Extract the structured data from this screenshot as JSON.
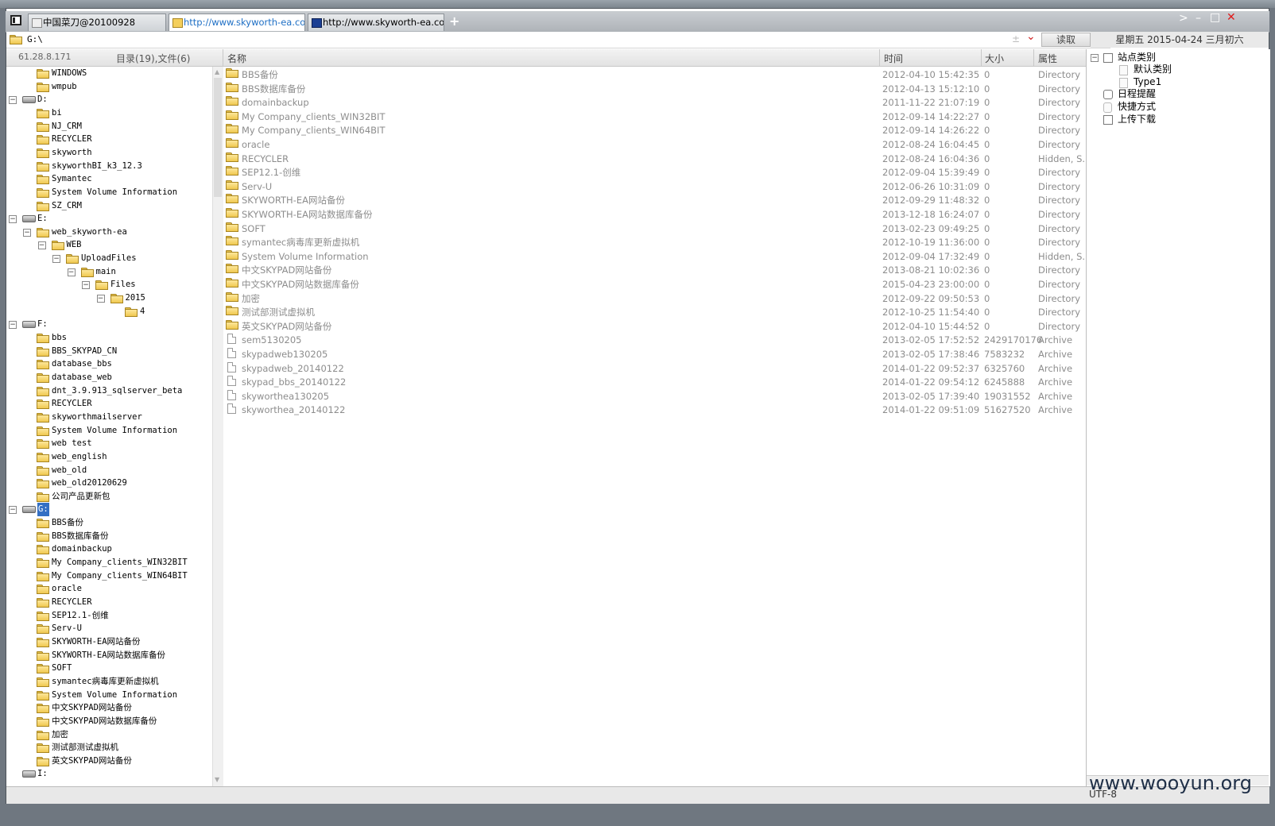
{
  "tabs": [
    {
      "label": "中国菜刀@20100928",
      "active": false
    },
    {
      "label": "http://www.skyworth-ea.com...",
      "active": true
    },
    {
      "label": "http://www.skyworth-ea.com...",
      "active": false
    }
  ],
  "add_tab": "+",
  "window_controls": {
    "next": ">",
    "minimize": "–",
    "maximize": "□",
    "close": "✕"
  },
  "address": {
    "path": "G:\\",
    "plus_minus": "±",
    "dropdown": "⌄"
  },
  "read_button": "读取",
  "date": "星期五 2015-04-24 三月初六",
  "left_header": {
    "ip": "61.28.8.171",
    "summary": "目录(19),文件(6)"
  },
  "columns": {
    "name": "名称",
    "time": "时间",
    "size": "大小",
    "attr": "属性"
  },
  "tree": [
    {
      "label": "WINDOWS",
      "kind": "folder",
      "level": 2
    },
    {
      "label": "wmpub",
      "kind": "folder",
      "level": 2
    },
    {
      "label": "D:",
      "kind": "drive",
      "level": 0,
      "exp": "-"
    },
    {
      "label": "bi",
      "kind": "folder",
      "level": 2
    },
    {
      "label": "NJ_CRM",
      "kind": "folder",
      "level": 2
    },
    {
      "label": "RECYCLER",
      "kind": "folder",
      "level": 2
    },
    {
      "label": "skyworth",
      "kind": "folder",
      "level": 2
    },
    {
      "label": "skyworthBI_k3_12.3",
      "kind": "folder",
      "level": 2
    },
    {
      "label": "Symantec",
      "kind": "folder",
      "level": 2
    },
    {
      "label": "System Volume Information",
      "kind": "folder",
      "level": 2
    },
    {
      "label": "SZ_CRM",
      "kind": "folder",
      "level": 2
    },
    {
      "label": "E:",
      "kind": "drive",
      "level": 0,
      "exp": "-"
    },
    {
      "label": "web_skyworth-ea",
      "kind": "folder",
      "level": 2,
      "exp": "-"
    },
    {
      "label": "WEB",
      "kind": "folder",
      "level": 3,
      "exp": "-"
    },
    {
      "label": "UploadFiles",
      "kind": "folder",
      "level": 4,
      "exp": "-"
    },
    {
      "label": "main",
      "kind": "folder",
      "level": 5,
      "exp": "-"
    },
    {
      "label": "Files",
      "kind": "folder",
      "level": 6,
      "exp": "-"
    },
    {
      "label": "2015",
      "kind": "folder",
      "level": 7,
      "exp": "-"
    },
    {
      "label": "4",
      "kind": "folder",
      "level": 8
    },
    {
      "label": "F:",
      "kind": "drive",
      "level": 0,
      "exp": "-"
    },
    {
      "label": "bbs",
      "kind": "folder",
      "level": 2
    },
    {
      "label": "BBS_SKYPAD_CN",
      "kind": "folder",
      "level": 2
    },
    {
      "label": "database_bbs",
      "kind": "folder",
      "level": 2
    },
    {
      "label": "database_web",
      "kind": "folder",
      "level": 2
    },
    {
      "label": "dnt_3.9.913_sqlserver_beta",
      "kind": "folder",
      "level": 2
    },
    {
      "label": "RECYCLER",
      "kind": "folder",
      "level": 2
    },
    {
      "label": "skyworthmailserver",
      "kind": "folder",
      "level": 2
    },
    {
      "label": "System Volume Information",
      "kind": "folder",
      "level": 2
    },
    {
      "label": "web test",
      "kind": "folder",
      "level": 2
    },
    {
      "label": "web_english",
      "kind": "folder",
      "level": 2
    },
    {
      "label": "web_old",
      "kind": "folder",
      "level": 2
    },
    {
      "label": "web_old20120629",
      "kind": "folder",
      "level": 2
    },
    {
      "label": "公司产品更新包",
      "kind": "folder",
      "level": 2
    },
    {
      "label": "G:",
      "kind": "drive",
      "level": 0,
      "exp": "-",
      "selected": true
    },
    {
      "label": "BBS备份",
      "kind": "folder",
      "level": 2
    },
    {
      "label": "BBS数据库备份",
      "kind": "folder",
      "level": 2
    },
    {
      "label": "domainbackup",
      "kind": "folder",
      "level": 2
    },
    {
      "label": "My Company_clients_WIN32BIT",
      "kind": "folder",
      "level": 2
    },
    {
      "label": "My Company_clients_WIN64BIT",
      "kind": "folder",
      "level": 2
    },
    {
      "label": "oracle",
      "kind": "folder",
      "level": 2
    },
    {
      "label": "RECYCLER",
      "kind": "folder",
      "level": 2
    },
    {
      "label": "SEP12.1-创维",
      "kind": "folder",
      "level": 2
    },
    {
      "label": "Serv-U",
      "kind": "folder",
      "level": 2
    },
    {
      "label": "SKYWORTH-EA网站备份",
      "kind": "folder",
      "level": 2
    },
    {
      "label": "SKYWORTH-EA网站数据库备份",
      "kind": "folder",
      "level": 2
    },
    {
      "label": "SOFT",
      "kind": "folder",
      "level": 2
    },
    {
      "label": "symantec病毒库更新虚拟机",
      "kind": "folder",
      "level": 2
    },
    {
      "label": "System Volume Information",
      "kind": "folder",
      "level": 2
    },
    {
      "label": "中文SKYPAD网站备份",
      "kind": "folder",
      "level": 2
    },
    {
      "label": "中文SKYPAD网站数据库备份",
      "kind": "folder",
      "level": 2
    },
    {
      "label": "加密",
      "kind": "folder",
      "level": 2
    },
    {
      "label": "测试部测试虚拟机",
      "kind": "folder",
      "level": 2
    },
    {
      "label": "英文SKYPAD网站备份",
      "kind": "folder",
      "level": 2
    },
    {
      "label": "I:",
      "kind": "drive",
      "level": 0
    }
  ],
  "files": [
    {
      "name": "BBS备份",
      "time": "2012-04-10 15:42:35",
      "size": "0",
      "attr": "Directory",
      "type": "dir"
    },
    {
      "name": "BBS数据库备份",
      "time": "2012-04-13 15:12:10",
      "size": "0",
      "attr": "Directory",
      "type": "dir"
    },
    {
      "name": "domainbackup",
      "time": "2011-11-22 21:07:19",
      "size": "0",
      "attr": "Directory",
      "type": "dir"
    },
    {
      "name": "My Company_clients_WIN32BIT",
      "time": "2012-09-14 14:22:27",
      "size": "0",
      "attr": "Directory",
      "type": "dir"
    },
    {
      "name": "My Company_clients_WIN64BIT",
      "time": "2012-09-14 14:26:22",
      "size": "0",
      "attr": "Directory",
      "type": "dir"
    },
    {
      "name": "oracle",
      "time": "2012-08-24 16:04:45",
      "size": "0",
      "attr": "Directory",
      "type": "dir"
    },
    {
      "name": "RECYCLER",
      "time": "2012-08-24 16:04:36",
      "size": "0",
      "attr": "Hidden, S...",
      "type": "dir"
    },
    {
      "name": "SEP12.1-创维",
      "time": "2012-09-04 15:39:49",
      "size": "0",
      "attr": "Directory",
      "type": "dir"
    },
    {
      "name": "Serv-U",
      "time": "2012-06-26 10:31:09",
      "size": "0",
      "attr": "Directory",
      "type": "dir"
    },
    {
      "name": "SKYWORTH-EA网站备份",
      "time": "2012-09-29 11:48:32",
      "size": "0",
      "attr": "Directory",
      "type": "dir"
    },
    {
      "name": "SKYWORTH-EA网站数据库备份",
      "time": "2013-12-18 16:24:07",
      "size": "0",
      "attr": "Directory",
      "type": "dir"
    },
    {
      "name": "SOFT",
      "time": "2013-02-23 09:49:25",
      "size": "0",
      "attr": "Directory",
      "type": "dir"
    },
    {
      "name": "symantec病毒库更新虚拟机",
      "time": "2012-10-19 11:36:00",
      "size": "0",
      "attr": "Directory",
      "type": "dir"
    },
    {
      "name": "System Volume Information",
      "time": "2012-09-04 17:32:49",
      "size": "0",
      "attr": "Hidden, S...",
      "type": "dir"
    },
    {
      "name": "中文SKYPAD网站备份",
      "time": "2013-08-21 10:02:36",
      "size": "0",
      "attr": "Directory",
      "type": "dir"
    },
    {
      "name": "中文SKYPAD网站数据库备份",
      "time": "2015-04-23 23:00:00",
      "size": "0",
      "attr": "Directory",
      "type": "dir"
    },
    {
      "name": "加密",
      "time": "2012-09-22 09:50:53",
      "size": "0",
      "attr": "Directory",
      "type": "dir"
    },
    {
      "name": "测试部测试虚拟机",
      "time": "2012-10-25 11:54:40",
      "size": "0",
      "attr": "Directory",
      "type": "dir"
    },
    {
      "name": "英文SKYPAD网站备份",
      "time": "2012-04-10 15:44:52",
      "size": "0",
      "attr": "Directory",
      "type": "dir"
    },
    {
      "name": "sem5130205",
      "time": "2013-02-05 17:52:52",
      "size": "2429170176",
      "attr": "Archive",
      "type": "file"
    },
    {
      "name": "skypadweb130205",
      "time": "2013-02-05 17:38:46",
      "size": "7583232",
      "attr": "Archive",
      "type": "file"
    },
    {
      "name": "skypadweb_20140122",
      "time": "2014-01-22 09:52:37",
      "size": "6325760",
      "attr": "Archive",
      "type": "file"
    },
    {
      "name": "skypad_bbs_20140122",
      "time": "2014-01-22 09:54:12",
      "size": "6245888",
      "attr": "Archive",
      "type": "file"
    },
    {
      "name": "skyworthea130205",
      "time": "2013-02-05 17:39:40",
      "size": "19031552",
      "attr": "Archive",
      "type": "file"
    },
    {
      "name": "skyworthea_20140122",
      "time": "2014-01-22 09:51:09",
      "size": "51627520",
      "attr": "Archive",
      "type": "file"
    }
  ],
  "right_panel": [
    {
      "label": "站点类别",
      "exp": "-",
      "level": 0,
      "icon": "checkbox"
    },
    {
      "label": "默认类别",
      "level": 1,
      "icon": "small"
    },
    {
      "label": "Type1",
      "level": 1,
      "icon": "small"
    },
    {
      "label": "日程提醒",
      "level": 0,
      "icon": "clock"
    },
    {
      "label": "快捷方式",
      "level": 0,
      "icon": "shortcut"
    },
    {
      "label": "上传下载",
      "level": 0,
      "icon": "checkbox"
    }
  ],
  "status": {
    "encoding": "UTF-8"
  },
  "watermark": "www.wooyun.org"
}
